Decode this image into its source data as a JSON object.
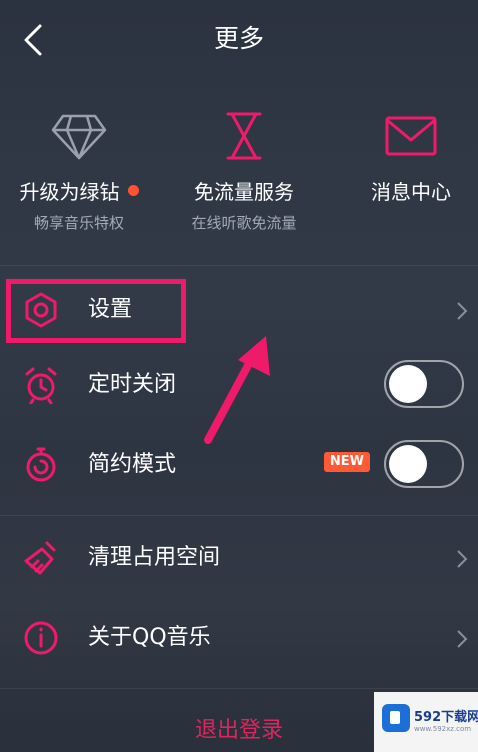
{
  "header": {
    "title": "更多"
  },
  "features": [
    {
      "label": "升级为绿钻",
      "sub": "畅享音乐特权",
      "icon": "diamond-icon",
      "has_dot": true
    },
    {
      "label": "免流量服务",
      "sub": "在线听歌免流量",
      "icon": "hourglass-icon"
    },
    {
      "label": "消息中心",
      "sub": "",
      "icon": "envelope-icon"
    }
  ],
  "settings": [
    {
      "label": "设置",
      "icon": "gear-icon"
    },
    {
      "label": "定时关闭",
      "icon": "alarm-clock-icon",
      "toggle": false
    },
    {
      "label": "简约模式",
      "icon": "stopwatch-icon",
      "toggle": false,
      "badge": "NEW"
    },
    {
      "label": "清理占用空间",
      "icon": "broom-icon"
    },
    {
      "label": "关于QQ音乐",
      "icon": "info-icon"
    }
  ],
  "logout": {
    "label": "退出登录"
  },
  "watermark": {
    "text": "592下载网",
    "sub": "www.592xz.com"
  },
  "colors": {
    "accent": "#f01a6a",
    "text": "#ffffff",
    "subtext": "#a3a9b4",
    "badge": "#ff5a36",
    "background": "#2f3744"
  }
}
